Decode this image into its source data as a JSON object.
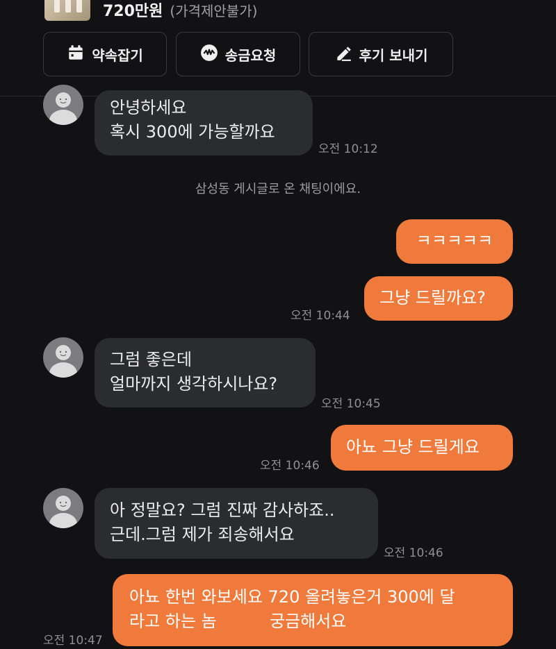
{
  "header": {
    "price": "720만원",
    "price_note": "(가격제안불가)",
    "buttons": [
      {
        "label": "약속잡기",
        "icon": "calendar-icon"
      },
      {
        "label": "송금요청",
        "icon": "transfer-icon"
      },
      {
        "label": "후기 보내기",
        "icon": "pen-icon"
      }
    ]
  },
  "system_message": "삼성동 게시글로 온 채팅이에요.",
  "messages": [
    {
      "sender": "other",
      "lines": [
        "안녕하세요",
        "혹시 300에 가능할까요"
      ],
      "time": "오전 10:12"
    },
    {
      "sender": "me",
      "lines": [
        "ㅋㅋㅋㅋㅋ"
      ]
    },
    {
      "sender": "me",
      "lines": [
        "그냥 드릴까요?"
      ],
      "time": "오전 10:44"
    },
    {
      "sender": "other",
      "lines": [
        "그럼 좋은데",
        "얼마까지 생각하시나요?"
      ],
      "time": "오전 10:45"
    },
    {
      "sender": "me",
      "lines": [
        "아뇨 그냥 드릴게요"
      ],
      "time": "오전 10:46"
    },
    {
      "sender": "other",
      "lines": [
        "아 정말요? 그럼 진짜 감사하죠..",
        "근데.그럼 제가 죄송해서요"
      ],
      "time": "오전 10:46"
    },
    {
      "sender": "me",
      "lines": [
        "아뇨 한번 와보세요 720 올려놓은거 300에 달",
        "라고 하는 놈          궁금해서요"
      ],
      "time": "오전 10:47"
    }
  ],
  "colors": {
    "background": "#121214",
    "incoming_bubble": "#2b2c30",
    "outgoing_bubble": "#f07a3c"
  }
}
